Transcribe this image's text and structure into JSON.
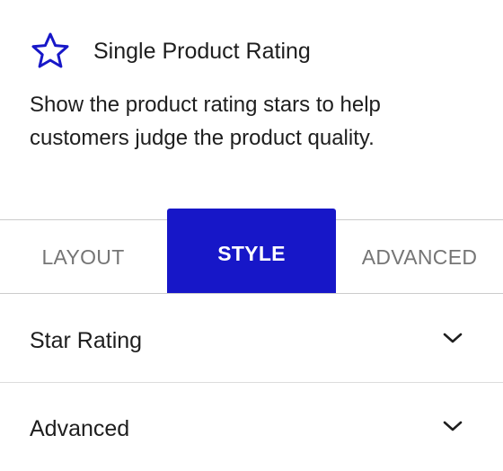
{
  "block": {
    "icon": "star-icon",
    "title": "Single Product Rating",
    "description": "Show the product rating stars to help customers judge the product quality."
  },
  "tabs": [
    {
      "label": "Layout",
      "active": false
    },
    {
      "label": "Style",
      "active": true
    },
    {
      "label": "Advanced",
      "active": false
    }
  ],
  "panels": [
    {
      "title": "Star Rating",
      "icon": "chevron-down-icon"
    },
    {
      "title": "Advanced",
      "icon": "chevron-down-icon"
    }
  ],
  "colors": {
    "accent": "#1717c8",
    "icon": "#1717c8",
    "text": "#1e1e1e",
    "muted": "#757575"
  }
}
